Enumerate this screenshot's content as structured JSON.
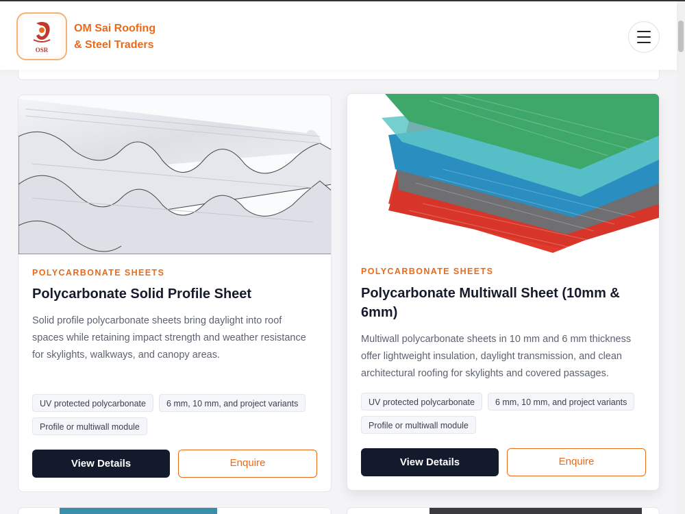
{
  "brand": {
    "name_line1": "OM Sai Roofing",
    "name_line2": "& Steel Traders",
    "logo_text": "OSR",
    "logo_colors": {
      "primary": "#c0392b",
      "accent": "#ea6a1a"
    }
  },
  "header": {
    "menu_icon": "hamburger-menu-icon"
  },
  "colors": {
    "accent": "#ea6a1a",
    "dark_button": "#121a2b",
    "title": "#161b2c"
  },
  "products": [
    {
      "category": "POLYCARBONATE SHEETS",
      "title": "Polycarbonate Solid Profile Sheet",
      "description": "Solid profile polycarbonate sheets bring daylight into roof spaces while retaining impact strength and weather resistance for skylights, walkways, and canopy areas.",
      "tags": [
        "UV protected polycarbonate",
        "6 mm, 10 mm, and project variants",
        "Profile or multiwall module"
      ],
      "view_label": "View Details",
      "enquire_label": "Enquire"
    },
    {
      "category": "POLYCARBONATE SHEETS",
      "title": "Polycarbonate Multiwall Sheet (10mm & 6mm)",
      "description": "Multiwall polycarbonate sheets in 10 mm and 6 mm thickness offer lightweight insulation, daylight transmission, and clean architectural roofing for skylights and covered passages.",
      "tags": [
        "UV protected polycarbonate",
        "6 mm, 10 mm, and project variants",
        "Profile or multiwall module"
      ],
      "view_label": "View Details",
      "enquire_label": "Enquire"
    }
  ]
}
